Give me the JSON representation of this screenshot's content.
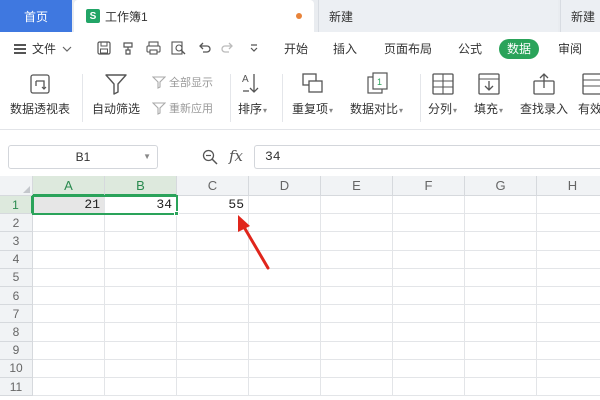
{
  "tabs": {
    "home": "首页",
    "active": "工作簿1",
    "active_icon": "S",
    "new1": "新建",
    "new2": "新建"
  },
  "menu": {
    "file": "文件",
    "tabs": [
      "开始",
      "插入",
      "页面布局",
      "公式",
      "数据",
      "审阅"
    ],
    "active_tab": "数据",
    "accent_color": "#2aa35a"
  },
  "ribbon": {
    "pivot": "数据透视表",
    "autofilter": "自动筛选",
    "show_all": "全部显示",
    "reapply": "重新应用",
    "sort": "排序",
    "duplicates": "重复项",
    "compare": "数据对比",
    "split": "分列",
    "fill": "填充",
    "lookup": "查找录入",
    "valid": "有效"
  },
  "formula": {
    "name_box": "B1",
    "fx": "fx",
    "value": "34"
  },
  "grid": {
    "columns": [
      "A",
      "B",
      "C",
      "D",
      "E",
      "F",
      "G",
      "H"
    ],
    "rows": [
      "1",
      "2",
      "3",
      "4",
      "5",
      "6",
      "7",
      "8",
      "9",
      "10",
      "11"
    ],
    "cells": {
      "A1": "21",
      "B1": "34",
      "C1": "55"
    },
    "selection": "A1:B1",
    "active_cell": "B1"
  },
  "annotation": {
    "arrow_color": "#e0251b"
  }
}
